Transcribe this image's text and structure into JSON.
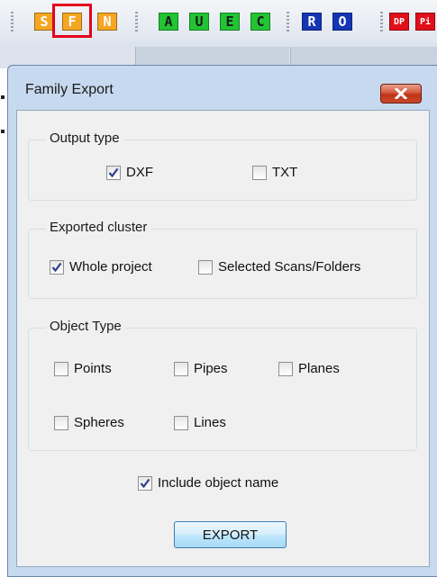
{
  "toolbar": {
    "buttons": [
      {
        "label": "S",
        "fg": "#ffffff",
        "bg": "#f5a623",
        "name": "toolbar-button-s"
      },
      {
        "label": "F",
        "fg": "#ffffff",
        "bg": "#f5a623",
        "name": "toolbar-button-f"
      },
      {
        "label": "N",
        "fg": "#ffffff",
        "bg": "#f5a623",
        "name": "toolbar-button-n"
      },
      {
        "label": "A",
        "fg": "#1a1a1a",
        "bg": "#22c434",
        "name": "toolbar-button-a"
      },
      {
        "label": "U",
        "fg": "#1a1a1a",
        "bg": "#22c434",
        "name": "toolbar-button-u"
      },
      {
        "label": "E",
        "fg": "#1a1a1a",
        "bg": "#22c434",
        "name": "toolbar-button-e"
      },
      {
        "label": "C",
        "fg": "#1a1a1a",
        "bg": "#22c434",
        "name": "toolbar-button-c"
      },
      {
        "label": "R",
        "fg": "#ffffff",
        "bg": "#1436b4",
        "name": "toolbar-button-r"
      },
      {
        "label": "O",
        "fg": "#ffffff",
        "bg": "#1436b4",
        "name": "toolbar-button-o"
      },
      {
        "label": "DP",
        "fg": "#ffffff",
        "bg": "#e0101b",
        "name": "toolbar-button-dp"
      },
      {
        "label": "Pi",
        "fg": "#ffffff",
        "bg": "#e0101b",
        "name": "toolbar-button-pi"
      }
    ],
    "highlight_color": "#e3001b"
  },
  "dialog": {
    "title": "Family Export",
    "close_color": "#c9472c",
    "output_type": {
      "label": "Output type",
      "options": [
        {
          "label": "DXF",
          "checked": true
        },
        {
          "label": "TXT",
          "checked": false
        }
      ]
    },
    "exported_cluster": {
      "label": "Exported cluster",
      "options": [
        {
          "label": "Whole project",
          "checked": true
        },
        {
          "label": "Selected Scans/Folders",
          "checked": false
        }
      ]
    },
    "object_type": {
      "label": "Object Type",
      "options": [
        {
          "label": "Points",
          "checked": false
        },
        {
          "label": "Pipes",
          "checked": false
        },
        {
          "label": "Planes",
          "checked": false
        },
        {
          "label": "Spheres",
          "checked": false
        },
        {
          "label": "Lines",
          "checked": false
        }
      ]
    },
    "include_object_name": {
      "label": "Include object name",
      "checked": true
    },
    "export_button": "EXPORT"
  }
}
